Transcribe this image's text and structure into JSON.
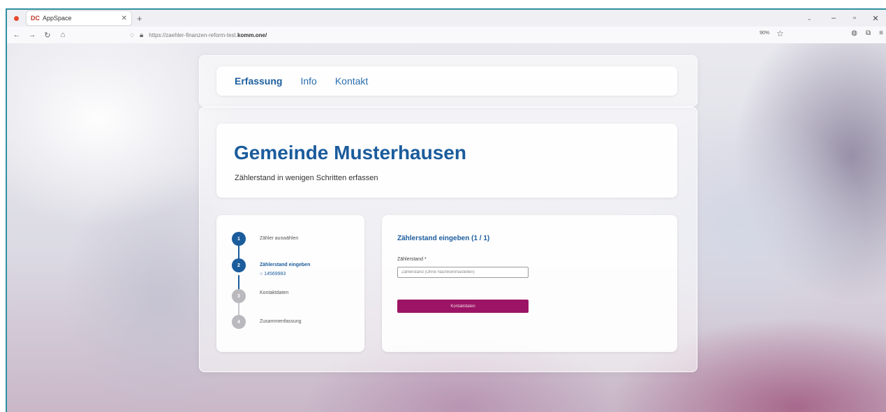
{
  "browser": {
    "tab_title": "AppSpace",
    "tab_favicon": "DC",
    "url_prefix": "https://zaehler-finanzen-reform-test.",
    "url_host": "komm.one/",
    "zoom": "90%",
    "icons": [
      "back-icon",
      "forward-icon",
      "reload-icon",
      "home-icon",
      "shield-icon",
      "lock-icon",
      "star-icon",
      "pocket-icon",
      "extensions-icon",
      "menu-icon"
    ]
  },
  "nav": {
    "items": [
      {
        "label": "Erfassung",
        "active": true
      },
      {
        "label": "Info",
        "active": false
      },
      {
        "label": "Kontakt",
        "active": false
      }
    ]
  },
  "hero": {
    "title": "Gemeinde Musterhausen",
    "subtitle": "Zählerstand in wenigen Schritten erfassen"
  },
  "steps": [
    {
      "num": "1",
      "label": "Zähler auswählen",
      "state": "done"
    },
    {
      "num": "2",
      "label": "Zählerstand eingeben",
      "state": "current",
      "detail": "○ 14569983"
    },
    {
      "num": "3",
      "label": "Kontaktdaten",
      "state": "todo"
    },
    {
      "num": "4",
      "label": "Zusammenfassung",
      "state": "todo"
    }
  ],
  "form": {
    "heading": "Zählerstand eingeben (1 / 1)",
    "field_label": "Zählerstand *",
    "field_placeholder": "Zählerstand (Ohne Nachkommastellen)",
    "field_value": "",
    "button_label": "Kontaktdaten"
  },
  "colors": {
    "primary": "#1b5c9c",
    "accent": "#9c1465",
    "step_inactive": "#b9b9be"
  }
}
